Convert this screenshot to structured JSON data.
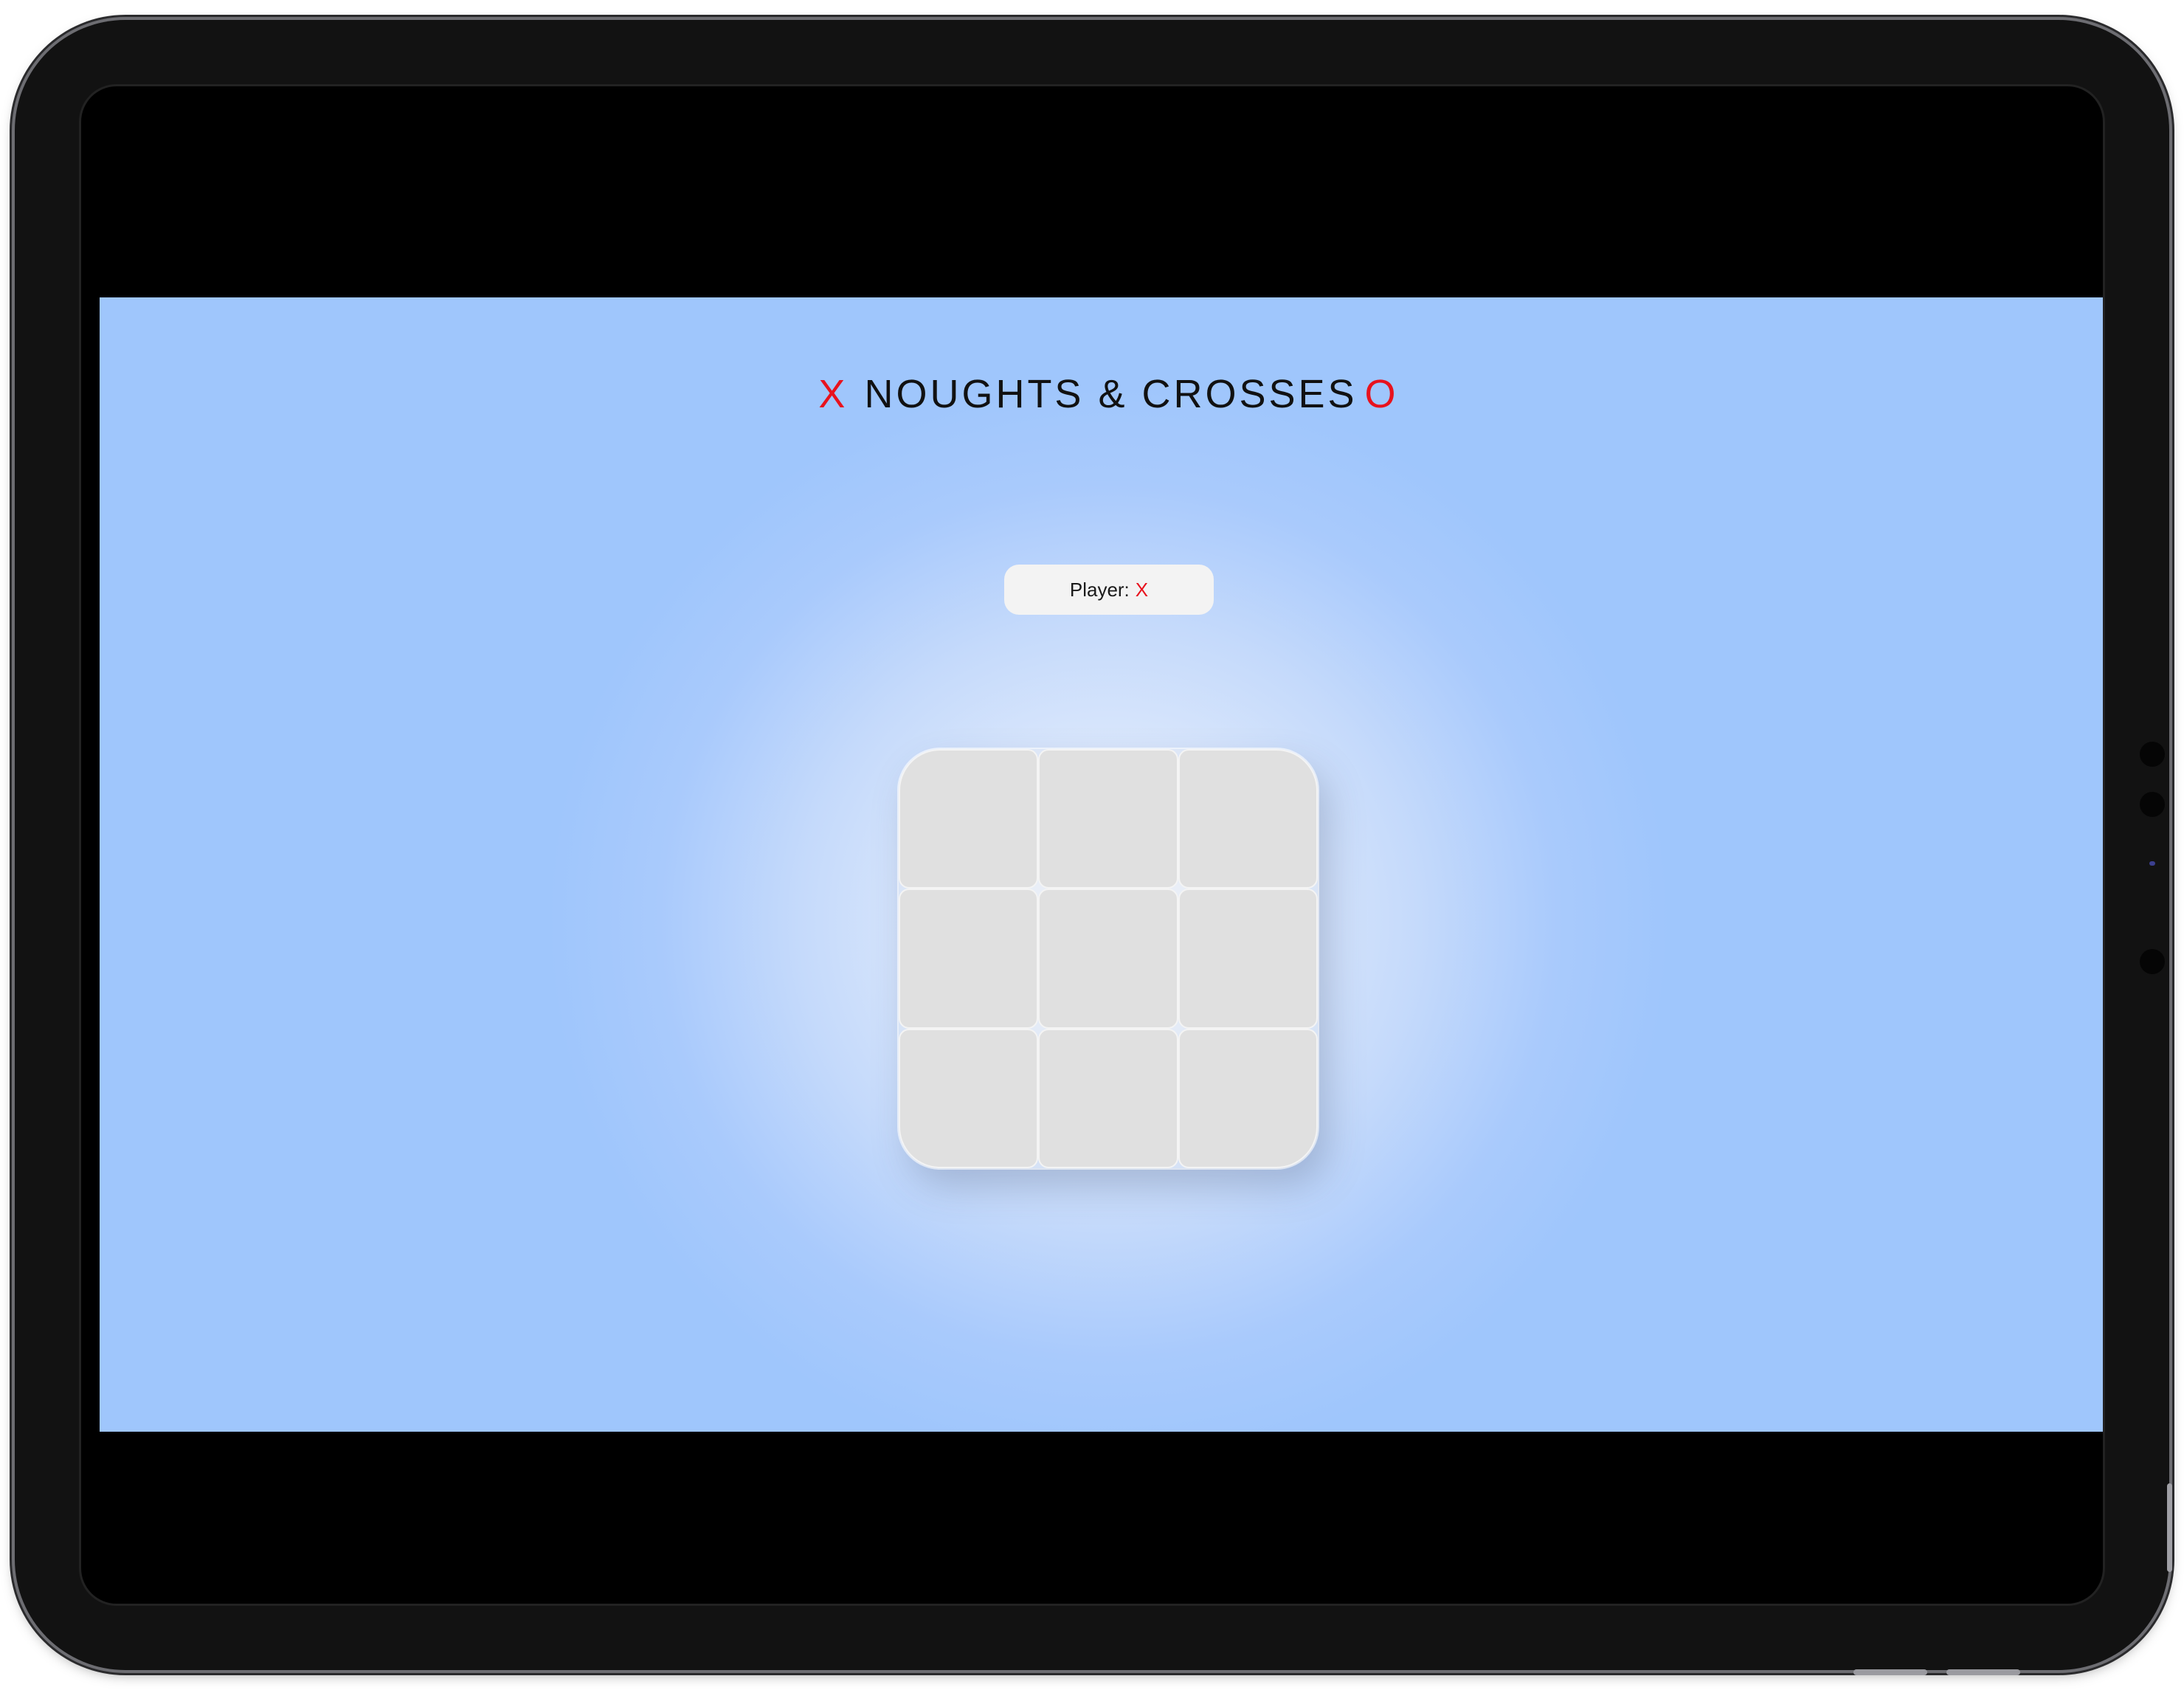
{
  "header": {
    "mark_left": "X",
    "title": "NOUGHTS & CROSSES",
    "mark_right": "O"
  },
  "status": {
    "label": "Player:",
    "current_player": "X"
  },
  "board": {
    "cells": [
      "",
      "",
      "",
      "",
      "",
      "",
      "",
      "",
      ""
    ]
  },
  "colors": {
    "accent": "#e8121d",
    "background": "#9fc6fc",
    "cell": "#e0e0e0"
  }
}
